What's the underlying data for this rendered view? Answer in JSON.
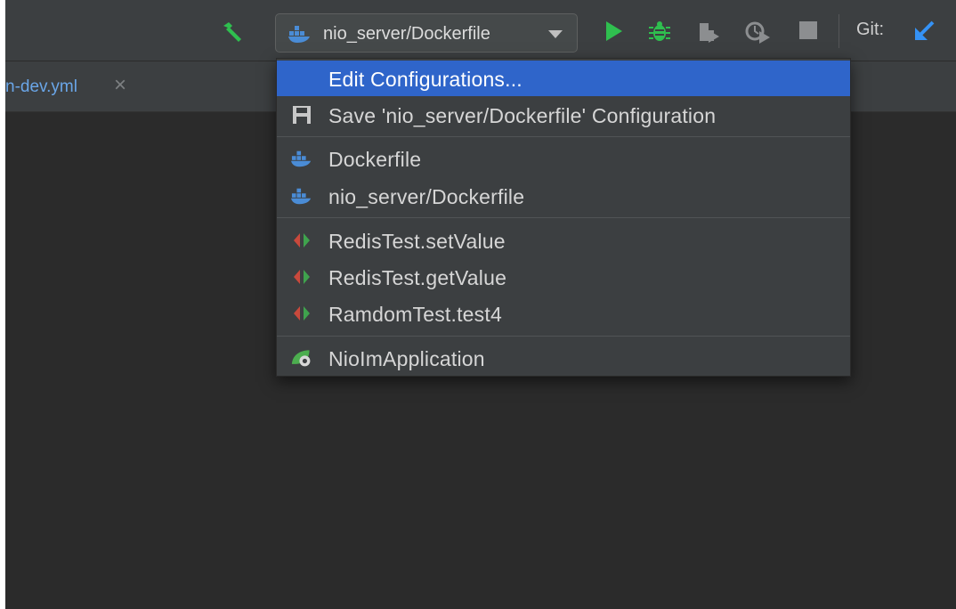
{
  "toolbar": {
    "run_config": {
      "label": "nio_server/Dockerfile",
      "icon": "docker-icon"
    },
    "git_label": "Git:",
    "icons": [
      "hammer-icon",
      "run-icon",
      "debug-icon",
      "coverage-icon",
      "profile-icon",
      "stop-icon",
      "vcs-update-icon"
    ]
  },
  "tab": {
    "label": "n-dev.yml",
    "close_glyph": "×"
  },
  "menu": {
    "items": [
      {
        "label": "Edit Configurations...",
        "icon": "",
        "selected": true
      },
      {
        "label": "Save 'nio_server/Dockerfile' Configuration",
        "icon": "save-icon"
      },
      {
        "label": "Dockerfile",
        "icon": "docker-icon"
      },
      {
        "label": "nio_server/Dockerfile",
        "icon": "docker-icon"
      },
      {
        "label": "RedisTest.setValue",
        "icon": "junit-test-icon"
      },
      {
        "label": "RedisTest.getValue",
        "icon": "junit-test-icon"
      },
      {
        "label": "RamdomTest.test4",
        "icon": "junit-test-icon"
      },
      {
        "label": "NioImApplication",
        "icon": "spring-boot-icon"
      }
    ]
  },
  "colors": {
    "selection": "#2f65ca",
    "run_green": "#2fbf4f",
    "docker_blue": "#4a8cd6",
    "git_blue": "#3592f5"
  }
}
